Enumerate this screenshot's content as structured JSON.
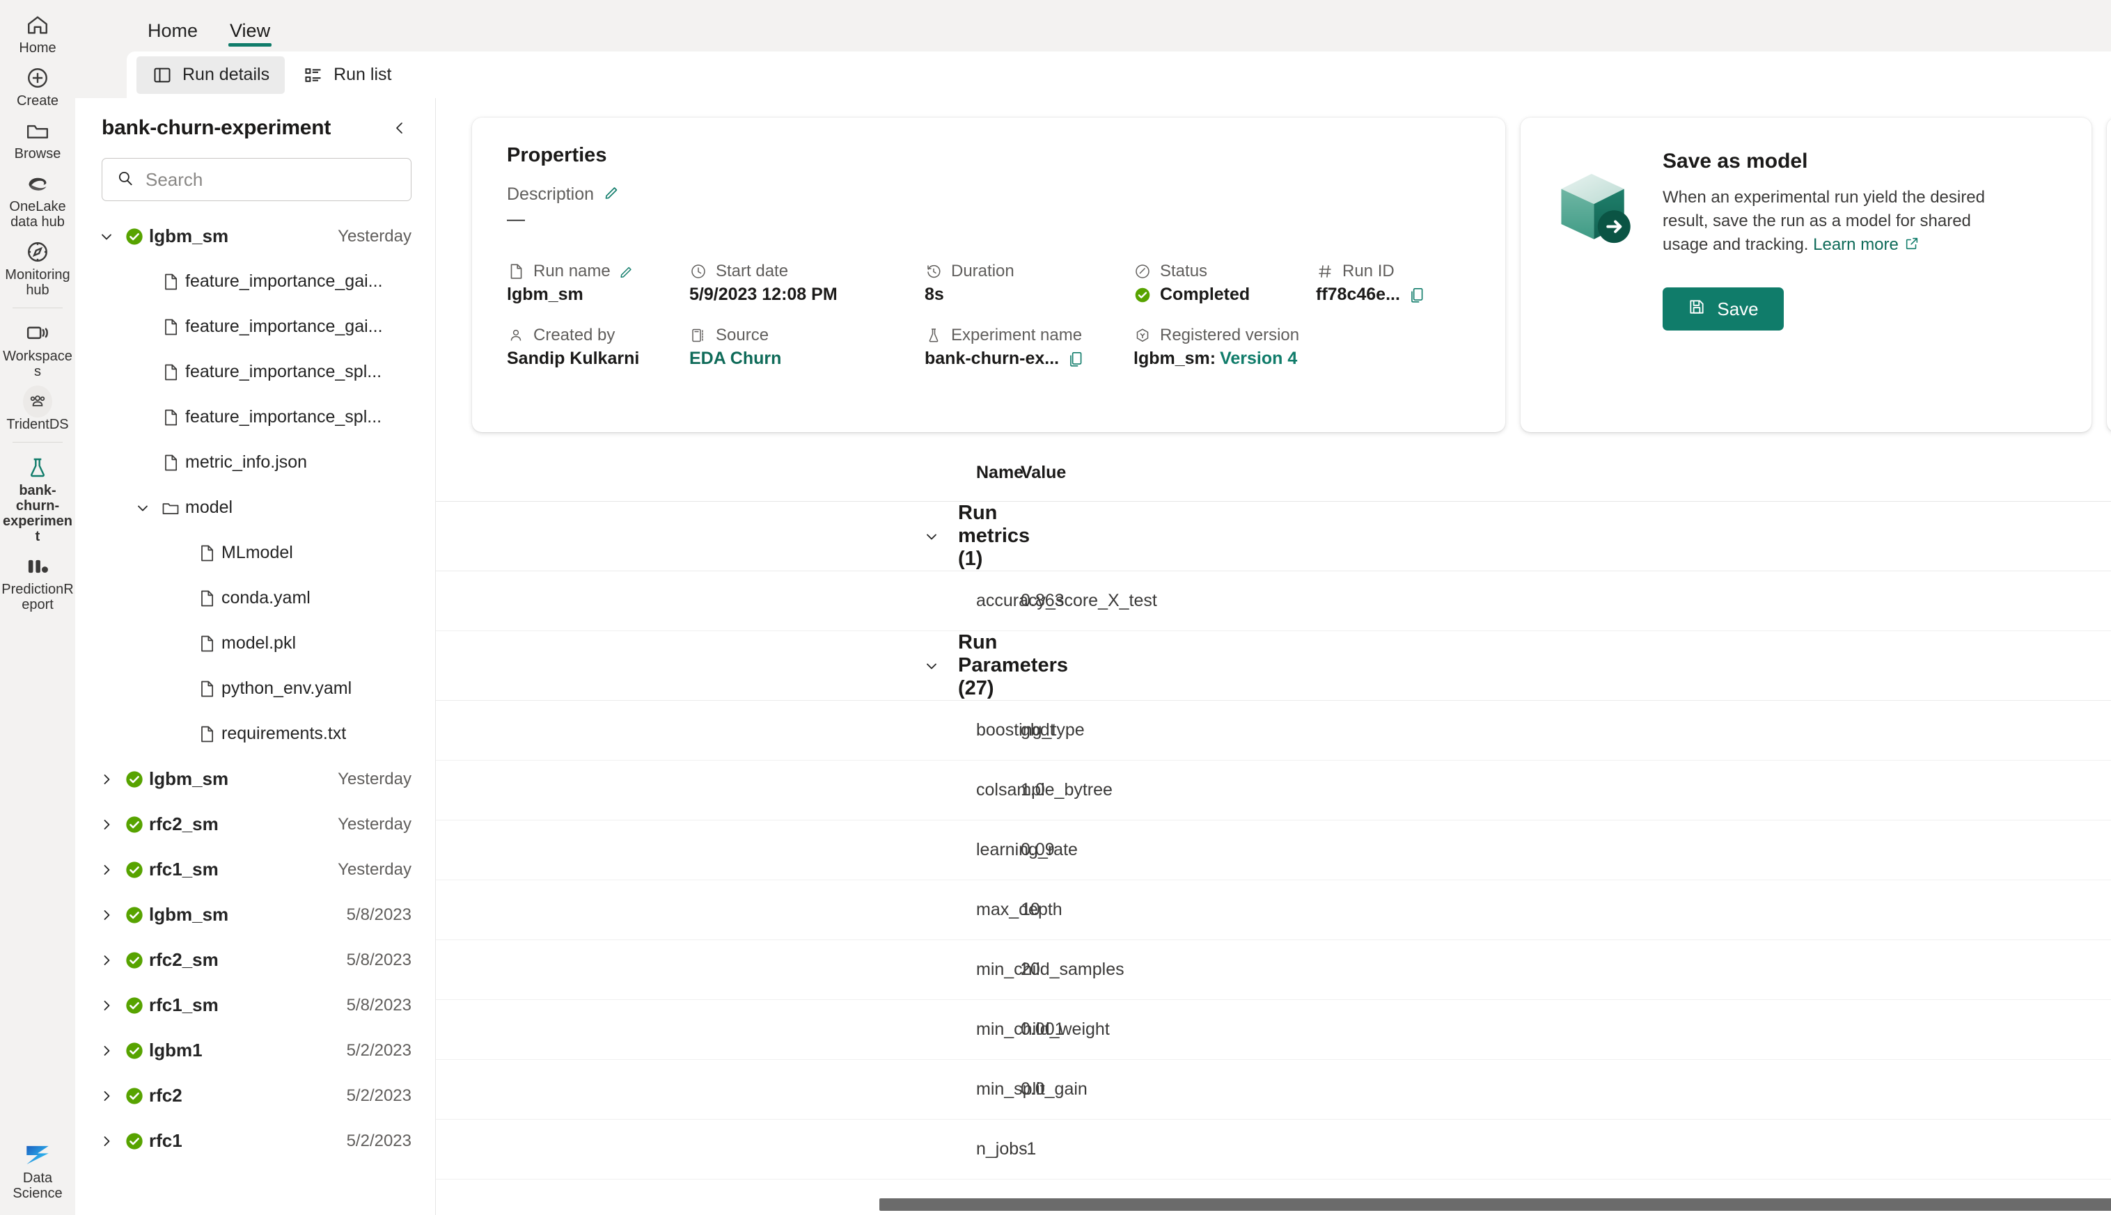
{
  "rail": {
    "items": [
      {
        "label": "Home",
        "icon": "home-icon"
      },
      {
        "label": "Create",
        "icon": "plus-circle-icon"
      },
      {
        "label": "Browse",
        "icon": "folder-icon"
      },
      {
        "label": "OneLake data hub",
        "icon": "onelake-icon"
      },
      {
        "label": "Monitoring hub",
        "icon": "compass-icon"
      },
      {
        "label": "Workspaces",
        "icon": "workspaces-icon"
      },
      {
        "label": "TridentDS",
        "icon": "people-group-icon"
      },
      {
        "label": "bank-churn-experiment",
        "icon": "flask-icon"
      },
      {
        "label": "PredictionReport",
        "icon": "report-bars-icon"
      }
    ],
    "bottom": {
      "label": "Data Science",
      "icon": "power-bi-icon"
    }
  },
  "ribbon": {
    "tabs": [
      {
        "label": "Home",
        "active": false
      },
      {
        "label": "View",
        "active": true
      }
    ]
  },
  "commandbar": {
    "buttons": [
      {
        "label": "Run details",
        "icon": "panel-layout-icon",
        "selected": true
      },
      {
        "label": "Run list",
        "icon": "list-icon",
        "selected": false
      }
    ]
  },
  "sidebar": {
    "title": "bank-churn-experiment",
    "collapse_icon": "chevron-left-icon",
    "search": {
      "placeholder": "Search",
      "value": "",
      "icon": "search-icon"
    },
    "tree": [
      {
        "depth": 0,
        "chev": "down",
        "icon": "status-success-icon",
        "label": "lgbm_sm",
        "date": "Yesterday",
        "bold": true
      },
      {
        "depth": 1,
        "chev": "none",
        "icon": "file-icon",
        "label": "feature_importance_gai...",
        "date": ""
      },
      {
        "depth": 1,
        "chev": "none",
        "icon": "file-icon",
        "label": "feature_importance_gai...",
        "date": ""
      },
      {
        "depth": 1,
        "chev": "none",
        "icon": "file-icon",
        "label": "feature_importance_spl...",
        "date": ""
      },
      {
        "depth": 1,
        "chev": "none",
        "icon": "file-icon",
        "label": "feature_importance_spl...",
        "date": ""
      },
      {
        "depth": 1,
        "chev": "none",
        "icon": "file-icon",
        "label": "metric_info.json",
        "date": ""
      },
      {
        "depth": 1,
        "chev": "down",
        "icon": "folder-open-icon",
        "label": "model",
        "date": ""
      },
      {
        "depth": 2,
        "chev": "none",
        "icon": "file-icon",
        "label": "MLmodel",
        "date": ""
      },
      {
        "depth": 2,
        "chev": "none",
        "icon": "file-icon",
        "label": "conda.yaml",
        "date": ""
      },
      {
        "depth": 2,
        "chev": "none",
        "icon": "file-icon",
        "label": "model.pkl",
        "date": ""
      },
      {
        "depth": 2,
        "chev": "none",
        "icon": "file-icon",
        "label": "python_env.yaml",
        "date": ""
      },
      {
        "depth": 2,
        "chev": "none",
        "icon": "file-icon",
        "label": "requirements.txt",
        "date": ""
      },
      {
        "depth": 0,
        "chev": "right",
        "icon": "status-success-icon",
        "label": "lgbm_sm",
        "date": "Yesterday",
        "bold": true
      },
      {
        "depth": 0,
        "chev": "right",
        "icon": "status-success-icon",
        "label": "rfc2_sm",
        "date": "Yesterday",
        "bold": true
      },
      {
        "depth": 0,
        "chev": "right",
        "icon": "status-success-icon",
        "label": "rfc1_sm",
        "date": "Yesterday",
        "bold": true
      },
      {
        "depth": 0,
        "chev": "right",
        "icon": "status-success-icon",
        "label": "lgbm_sm",
        "date": "5/8/2023",
        "bold": true
      },
      {
        "depth": 0,
        "chev": "right",
        "icon": "status-success-icon",
        "label": "rfc2_sm",
        "date": "5/8/2023",
        "bold": true
      },
      {
        "depth": 0,
        "chev": "right",
        "icon": "status-success-icon",
        "label": "rfc1_sm",
        "date": "5/8/2023",
        "bold": true
      },
      {
        "depth": 0,
        "chev": "right",
        "icon": "status-success-icon",
        "label": "lgbm1",
        "date": "5/2/2023",
        "bold": true
      },
      {
        "depth": 0,
        "chev": "right",
        "icon": "status-success-icon",
        "label": "rfc2",
        "date": "5/2/2023",
        "bold": true
      },
      {
        "depth": 0,
        "chev": "right",
        "icon": "status-success-icon",
        "label": "rfc1",
        "date": "5/2/2023",
        "bold": true
      }
    ]
  },
  "properties": {
    "title": "Properties",
    "description_label": "Description",
    "description_edit_icon": "pencil-icon",
    "description_value": "—",
    "fields": [
      {
        "label": "Run name",
        "value": "lgbm_sm",
        "icon": "file-icon",
        "edit": true,
        "link": false,
        "copy": false
      },
      {
        "label": "Start date",
        "value": "5/9/2023 12:08 PM",
        "icon": "clock-icon",
        "edit": false,
        "link": false,
        "copy": false
      },
      {
        "label": "Duration",
        "value": "8s",
        "icon": "history-icon",
        "edit": false,
        "link": false,
        "copy": false
      },
      {
        "label": "Status",
        "value": "Completed",
        "icon": "status-edit-icon",
        "edit": false,
        "link": false,
        "copy": false,
        "status": true
      },
      {
        "label": "Run ID",
        "value": "ff78c46e...",
        "icon": "hash-icon",
        "edit": false,
        "link": false,
        "copy": true
      },
      {
        "label": "Created by",
        "value": "Sandip Kulkarni",
        "icon": "person-icon",
        "edit": false,
        "link": false,
        "copy": false
      },
      {
        "label": "Source",
        "value": "EDA Churn",
        "icon": "notebook-icon",
        "edit": false,
        "link": true,
        "copy": false
      },
      {
        "label": "Experiment name",
        "value": "bank-churn-ex...",
        "icon": "flask-icon",
        "edit": false,
        "link": false,
        "copy": true
      },
      {
        "label": "Registered version",
        "value": "lgbm_sm: ",
        "value_link": "Version 4",
        "icon": "version-icon",
        "edit": false,
        "link": false,
        "copy": false
      }
    ]
  },
  "save_card": {
    "title": "Save as model",
    "body": "When an experimental run yield the desired result, save the run as a model for shared usage and tracking. ",
    "learn_more": "Learn more",
    "learn_more_icon": "external-link-icon",
    "button_label": "Save",
    "button_icon": "save-icon",
    "illustration": "model-cube-icon"
  },
  "table": {
    "columns": [
      "Name",
      "Value"
    ],
    "groups": [
      {
        "title": "Run metrics (1)",
        "expanded": true,
        "rows": [
          {
            "name": "accuracy_score_X_test",
            "value": "0.863"
          }
        ]
      },
      {
        "title": "Run Parameters (27)",
        "expanded": true,
        "rows": [
          {
            "name": "boosting_type",
            "value": "gbdt"
          },
          {
            "name": "colsample_bytree",
            "value": "1.0"
          },
          {
            "name": "learning_rate",
            "value": "0.09"
          },
          {
            "name": "max_depth",
            "value": "10"
          },
          {
            "name": "min_child_samples",
            "value": "20"
          },
          {
            "name": "min_child_weight",
            "value": "0.001"
          },
          {
            "name": "min_split_gain",
            "value": "0.0"
          },
          {
            "name": "n_jobs",
            "value": "-1"
          }
        ]
      }
    ]
  },
  "colors": {
    "accent": "#107c6a",
    "success": "#57a300",
    "rail_bg": "#f3f2f1"
  }
}
